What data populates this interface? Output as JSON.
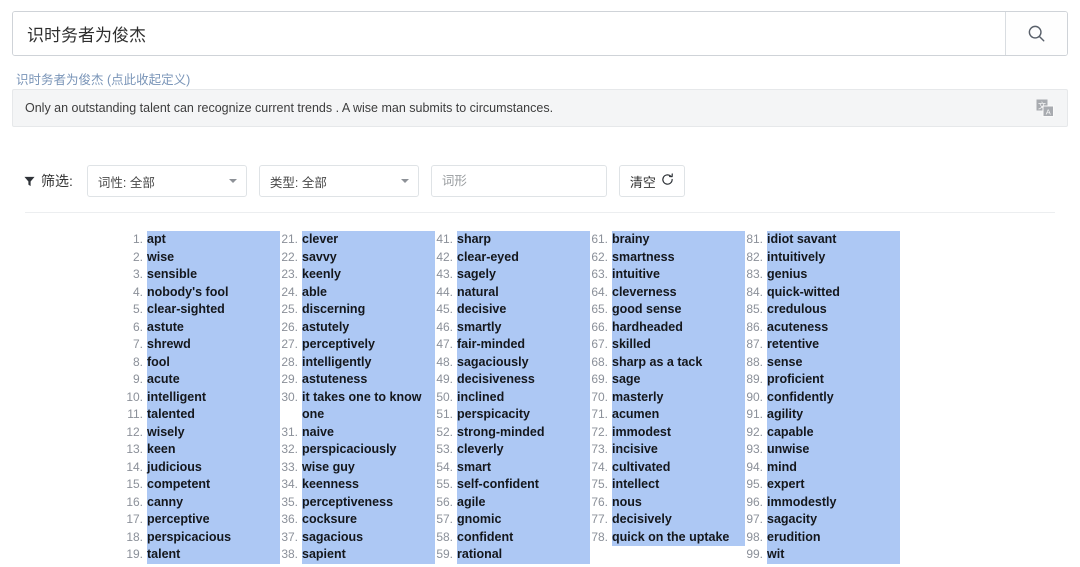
{
  "search": {
    "value": "识时务者为俊杰",
    "placeholder": "",
    "button_icon": "search-icon"
  },
  "definition": {
    "toggle_link": "识时务者为俊杰 (点此收起定义)",
    "text": "Only an outstanding talent can recognize current trends . A wise man submits to circumstances.",
    "action_icon": "translate-icon"
  },
  "filter": {
    "label": "筛选:",
    "icon": "funnel-icon",
    "pos_select": "词性: 全部",
    "type_select": "类型: 全部",
    "form_placeholder": "词形",
    "form_value": "",
    "clear_label": "清空",
    "clear_icon": "refresh-icon"
  },
  "colors": {
    "selection_highlight": "#adc8f4",
    "number": "#8b9099",
    "word": "#14171c",
    "link": "#7a95b8",
    "definition_bg": "#f4f5f6",
    "border": "#dfe3e6"
  },
  "results": {
    "columns": [
      {
        "items": [
          {
            "n": "1.",
            "word": "apt"
          },
          {
            "n": "2.",
            "word": "wise"
          },
          {
            "n": "3.",
            "word": "sensible"
          },
          {
            "n": "4.",
            "word": "nobody's fool"
          },
          {
            "n": "5.",
            "word": "clear-sighted"
          },
          {
            "n": "6.",
            "word": "astute"
          },
          {
            "n": "7.",
            "word": "shrewd"
          },
          {
            "n": "8.",
            "word": "fool"
          },
          {
            "n": "9.",
            "word": "acute"
          },
          {
            "n": "10.",
            "word": "intelligent"
          },
          {
            "n": "11.",
            "word": "talented"
          },
          {
            "n": "12.",
            "word": "wisely"
          },
          {
            "n": "13.",
            "word": "keen"
          },
          {
            "n": "14.",
            "word": "judicious"
          },
          {
            "n": "15.",
            "word": "competent"
          },
          {
            "n": "16.",
            "word": "canny"
          },
          {
            "n": "17.",
            "word": "perceptive"
          },
          {
            "n": "18.",
            "word": "perspicacious"
          },
          {
            "n": "19.",
            "word": "talent"
          }
        ]
      },
      {
        "items": [
          {
            "n": "21.",
            "word": "clever"
          },
          {
            "n": "22.",
            "word": "savvy"
          },
          {
            "n": "23.",
            "word": "keenly"
          },
          {
            "n": "24.",
            "word": "able"
          },
          {
            "n": "25.",
            "word": "discerning"
          },
          {
            "n": "26.",
            "word": "astutely"
          },
          {
            "n": "27.",
            "word": "perceptively"
          },
          {
            "n": "28.",
            "word": "intelligently"
          },
          {
            "n": "29.",
            "word": "astuteness"
          },
          {
            "n": "30.",
            "word": "it takes one to know one"
          },
          {
            "n": "31.",
            "word": "naive"
          },
          {
            "n": "32.",
            "word": "perspicaciously"
          },
          {
            "n": "33.",
            "word": "wise guy"
          },
          {
            "n": "34.",
            "word": "keenness"
          },
          {
            "n": "35.",
            "word": "perceptiveness"
          },
          {
            "n": "36.",
            "word": "cocksure"
          },
          {
            "n": "37.",
            "word": "sagacious"
          },
          {
            "n": "38.",
            "word": "sapient"
          }
        ]
      },
      {
        "items": [
          {
            "n": "41.",
            "word": "sharp"
          },
          {
            "n": "42.",
            "word": "clear-eyed"
          },
          {
            "n": "43.",
            "word": "sagely"
          },
          {
            "n": "44.",
            "word": "natural"
          },
          {
            "n": "45.",
            "word": "decisive"
          },
          {
            "n": "46.",
            "word": "smartly"
          },
          {
            "n": "47.",
            "word": "fair-minded"
          },
          {
            "n": "48.",
            "word": "sagaciously"
          },
          {
            "n": "49.",
            "word": "decisiveness"
          },
          {
            "n": "50.",
            "word": "inclined"
          },
          {
            "n": "51.",
            "word": "perspicacity"
          },
          {
            "n": "52.",
            "word": "strong-minded"
          },
          {
            "n": "53.",
            "word": "cleverly"
          },
          {
            "n": "54.",
            "word": "smart"
          },
          {
            "n": "55.",
            "word": "self-confident"
          },
          {
            "n": "56.",
            "word": "agile"
          },
          {
            "n": "57.",
            "word": "gnomic"
          },
          {
            "n": "58.",
            "word": "confident"
          },
          {
            "n": "59.",
            "word": "rational"
          }
        ]
      },
      {
        "items": [
          {
            "n": "61.",
            "word": "brainy"
          },
          {
            "n": "62.",
            "word": "smartness"
          },
          {
            "n": "63.",
            "word": "intuitive"
          },
          {
            "n": "64.",
            "word": "cleverness"
          },
          {
            "n": "65.",
            "word": "good sense"
          },
          {
            "n": "66.",
            "word": "hardheaded"
          },
          {
            "n": "67.",
            "word": "skilled"
          },
          {
            "n": "68.",
            "word": "sharp as a tack"
          },
          {
            "n": "69.",
            "word": "sage"
          },
          {
            "n": "70.",
            "word": "masterly"
          },
          {
            "n": "71.",
            "word": "acumen"
          },
          {
            "n": "72.",
            "word": "immodest"
          },
          {
            "n": "73.",
            "word": "incisive"
          },
          {
            "n": "74.",
            "word": "cultivated"
          },
          {
            "n": "75.",
            "word": "intellect"
          },
          {
            "n": "76.",
            "word": "nous"
          },
          {
            "n": "77.",
            "word": "decisively"
          },
          {
            "n": "78.",
            "word": "quick on the uptake"
          }
        ]
      },
      {
        "items": [
          {
            "n": "81.",
            "word": "idiot savant"
          },
          {
            "n": "82.",
            "word": "intuitively"
          },
          {
            "n": "83.",
            "word": "genius"
          },
          {
            "n": "84.",
            "word": "quick-witted"
          },
          {
            "n": "85.",
            "word": "credulous"
          },
          {
            "n": "86.",
            "word": "acuteness"
          },
          {
            "n": "87.",
            "word": "retentive"
          },
          {
            "n": "88.",
            "word": "sense"
          },
          {
            "n": "89.",
            "word": "proficient"
          },
          {
            "n": "90.",
            "word": "confidently"
          },
          {
            "n": "91.",
            "word": "agility"
          },
          {
            "n": "92.",
            "word": "capable"
          },
          {
            "n": "93.",
            "word": "unwise"
          },
          {
            "n": "94.",
            "word": "mind"
          },
          {
            "n": "95.",
            "word": "expert"
          },
          {
            "n": "96.",
            "word": "immodestly"
          },
          {
            "n": "97.",
            "word": "sagacity"
          },
          {
            "n": "98.",
            "word": "erudition"
          },
          {
            "n": "99.",
            "word": "wit"
          }
        ]
      }
    ]
  }
}
